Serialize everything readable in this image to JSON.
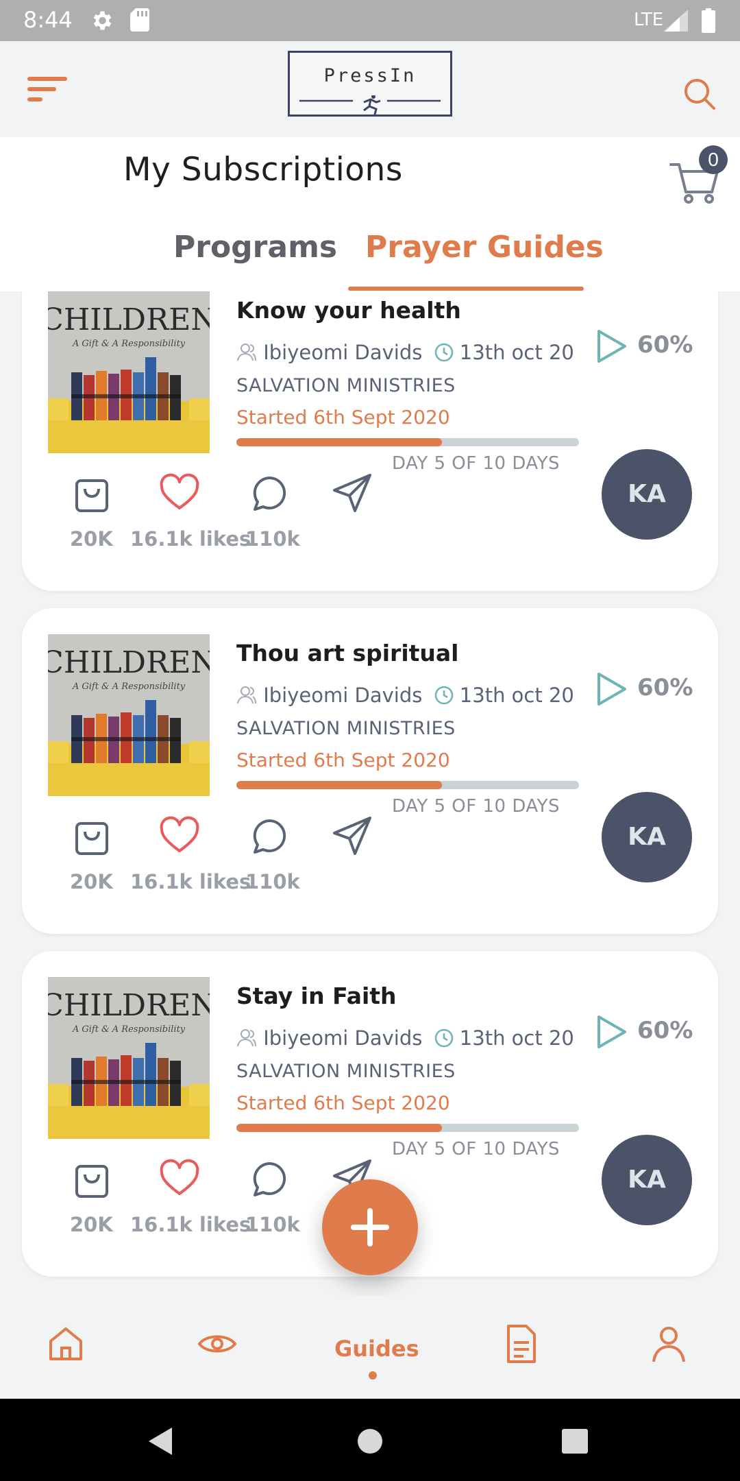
{
  "status_bar": {
    "time": "8:44",
    "network": "LTE"
  },
  "header": {
    "logo_text": "PressIn"
  },
  "subheader": {
    "title": "My Subscriptions",
    "cart_count": "0",
    "tabs": [
      {
        "label": "Programs",
        "active": false
      },
      {
        "label": "Prayer Guides",
        "active": true
      }
    ]
  },
  "cards": [
    {
      "title": "Know your health",
      "author": "Ibiyeomi Davids",
      "date": "13th oct 20",
      "org": "SALVATION MINISTRIES",
      "started": "Started 6th Sept 2020",
      "progress": 0.6,
      "day_text": "DAY 5 OF 10 DAYS",
      "percent": "60%",
      "avatar": "KA",
      "bag_count": "20K",
      "likes": "16.1k likes",
      "comments": "110k"
    },
    {
      "title": "Thou art spiritual",
      "author": "Ibiyeomi Davids",
      "date": "13th oct 20",
      "org": "SALVATION MINISTRIES",
      "started": "Started 6th Sept 2020",
      "progress": 0.6,
      "day_text": "DAY 5 OF 10 DAYS",
      "percent": "60%",
      "avatar": "KA",
      "bag_count": "20K",
      "likes": "16.1k likes",
      "comments": "110k"
    },
    {
      "title": "Stay in Faith",
      "author": "Ibiyeomi Davids",
      "date": "13th oct 20",
      "org": "SALVATION MINISTRIES",
      "started": "Started 6th Sept 2020",
      "progress": 0.6,
      "day_text": "DAY 5 OF 10 DAYS",
      "percent": "60%",
      "avatar": "KA",
      "bag_count": "20K",
      "likes": "16.1k likes",
      "comments": "110k"
    }
  ],
  "thumbnail": {
    "title": "CHILDREN",
    "subtitle": "A Gift & A Responsibility"
  },
  "bottom_nav": {
    "items": [
      {
        "icon": "home-icon"
      },
      {
        "icon": "eye-icon"
      },
      {
        "label": "Guides",
        "active": true
      },
      {
        "icon": "document-icon"
      },
      {
        "icon": "profile-icon"
      }
    ]
  },
  "colors": {
    "accent": "#e07b4c",
    "dark": "#4a5368",
    "teal": "#6cb5b4",
    "heart": "#ea5a5a"
  }
}
